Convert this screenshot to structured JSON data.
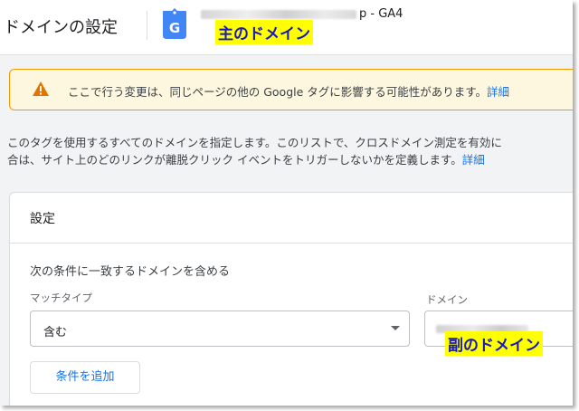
{
  "header": {
    "title": "ドメインの設定",
    "property_suffix": "p - GA4",
    "tag_letter": "G",
    "annotation": "主のドメイン"
  },
  "alert": {
    "text": "ここで行う変更は、同じページの他の Google タグに影響する可能性があります。",
    "link": "詳細"
  },
  "description": {
    "line1": "このタグを使用するすべてのドメインを指定します。このリストで、クロスドメイン測定を有効に",
    "line2": "合は、サイト上のどのリンクが離脱クリック イベントをトリガーしないかを定義します。",
    "link": "詳細"
  },
  "settings": {
    "title": "設定",
    "condition_label": "次の条件に一致するドメインを含める",
    "match_type_label": "マッチタイプ",
    "match_type_value": "含む",
    "domain_label": "ドメイン",
    "add_condition_button": "条件を追加",
    "annotation": "副のドメイン"
  },
  "colors": {
    "accent": "#1a73e8",
    "warning": "#f29900",
    "warning_bg": "#fef7e0",
    "tag_icon": "#4285f4",
    "annotation_bg": "#ffff00",
    "annotation_text": "#1a1ab8"
  },
  "icons": [
    "google-tag-icon",
    "warning-icon",
    "dropdown-arrow-icon"
  ]
}
